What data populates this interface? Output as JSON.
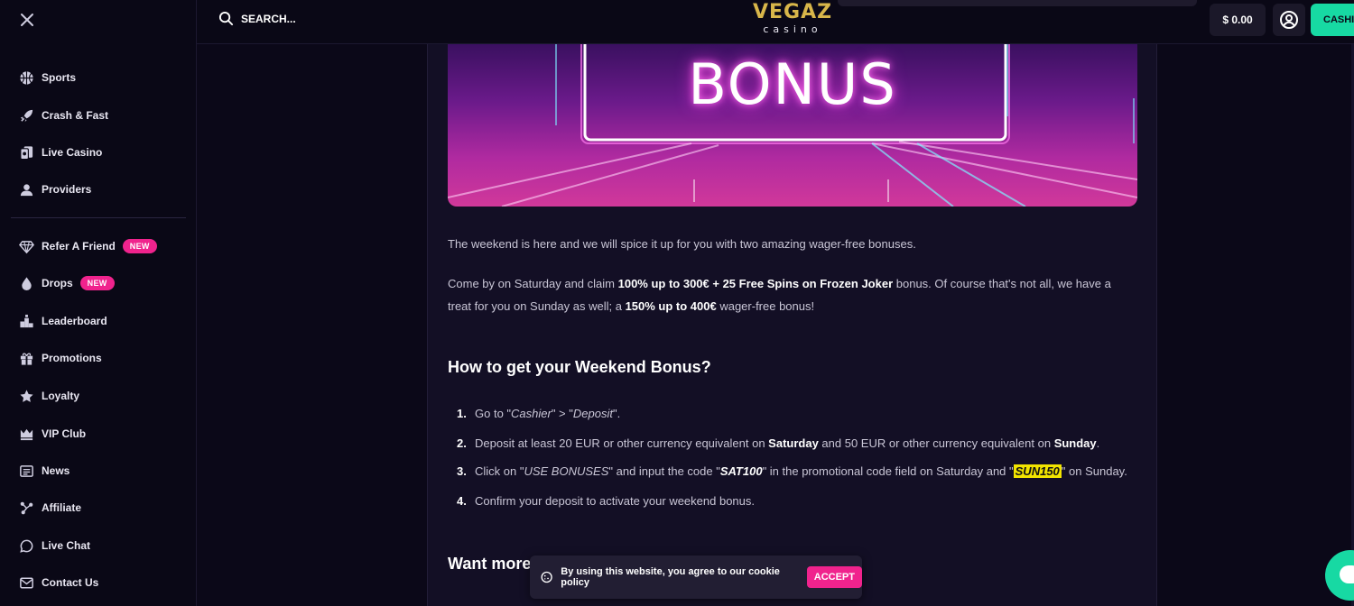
{
  "header": {
    "search_label": "SEARCH...",
    "logo_main": "VEGAZ",
    "logo_sub": "casino",
    "balance": "$ 0.00",
    "cashier_label": "CASHIER"
  },
  "sidebar": {
    "items": [
      {
        "label": "Sports",
        "icon": "basketball-icon"
      },
      {
        "label": "Crash & Fast",
        "icon": "rocket-icon"
      },
      {
        "label": "Live Casino",
        "icon": "cards-icon"
      },
      {
        "label": "Providers",
        "icon": "person-icon"
      },
      {
        "label": "Refer A Friend",
        "icon": "diamond-icon",
        "badge": "NEW"
      },
      {
        "label": "Drops",
        "icon": "drop-icon",
        "badge": "NEW"
      },
      {
        "label": "Leaderboard",
        "icon": "podium-icon"
      },
      {
        "label": "Promotions",
        "icon": "gift-icon"
      },
      {
        "label": "Loyalty",
        "icon": "star-icon"
      },
      {
        "label": "VIP Club",
        "icon": "crown-icon"
      },
      {
        "label": "News",
        "icon": "newspaper-icon"
      },
      {
        "label": "Affiliate",
        "icon": "network-icon"
      },
      {
        "label": "Live Chat",
        "icon": "chat-icon"
      },
      {
        "label": "Contact Us",
        "icon": "mail-icon"
      }
    ]
  },
  "article": {
    "banner_text": "BONUS",
    "intro": "The weekend is here and we will spice it up for you with two amazing wager-free bonuses.",
    "para2_a": "Come by on Saturday and claim ",
    "para2_b": "100% up to 300€ + 25 Free Spins on Frozen Joker",
    "para2_c": " bonus. Of course that's not all, we have a treat for you on Sunday as well; a ",
    "para2_d": "150% up to 400€",
    "para2_e": " wager-free bonus!",
    "heading": "How to get your Weekend Bonus?",
    "steps": [
      {
        "num": "1.",
        "a": "Go to \"",
        "b": "Cashier",
        "c": "\" > \"",
        "d": "Deposit",
        "e": "\"."
      },
      {
        "num": "2.",
        "a": "Deposit at least 20 EUR or other currency equivalent on ",
        "b": "Saturday",
        "c": " and 50 EUR or other currency equivalent on ",
        "d": "Sunday",
        "e": "."
      },
      {
        "num": "3.",
        "a": "Click on \"",
        "b": "USE BONUSES",
        "c": "\" and input the code \"",
        "d": "SAT100",
        "e": "\" in the promotional code field on Saturday and \"",
        "f": "SUN150",
        "g": "\" on Sunday."
      },
      {
        "num": "4.",
        "a": "Confirm your deposit to activate your weekend bonus."
      }
    ],
    "heading2": "Want more"
  },
  "cookie": {
    "text": "By using this website, you agree to our ",
    "link": "cookie policy",
    "accept": "ACCEPT"
  },
  "colors": {
    "accent_pink": "#f0238d",
    "accent_green": "#17d9a3",
    "logo_gold": "#d8b64a",
    "highlight_yellow": "#f2e400"
  }
}
